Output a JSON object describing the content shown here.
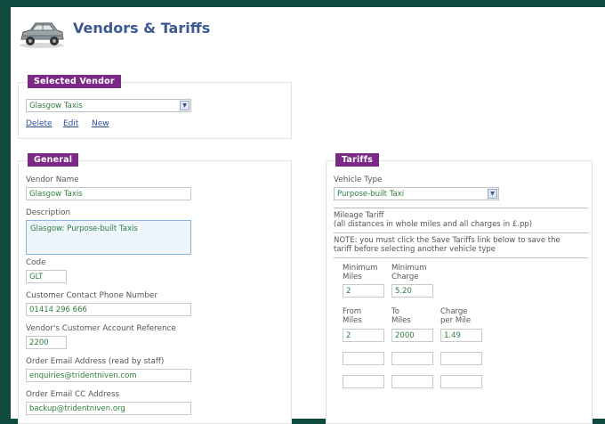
{
  "header": {
    "title": "Vendors & Tariffs",
    "icon": "car-icon"
  },
  "selected_vendor": {
    "tag": "Selected Vendor",
    "value": "Glasgow Taxis",
    "links": {
      "delete": "Delete",
      "edit": "Edit",
      "new": "New"
    }
  },
  "general": {
    "tag": "General",
    "vendor_name": {
      "label": "Vendor Name",
      "value": "Glasgow Taxis"
    },
    "description": {
      "label": "Description",
      "value": "Glasgow: Purpose-built Taxis"
    },
    "code": {
      "label": "Code",
      "value": "GLT"
    },
    "phone": {
      "label": "Customer Contact Phone Number",
      "value": "01414 296 666"
    },
    "account_ref": {
      "label": "Vendor's Customer Account Reference",
      "value": "2200"
    },
    "order_email": {
      "label": "Order Email Address (read by staff)",
      "value": "enquiries@tridentniven.com"
    },
    "cc_email": {
      "label": "Order Email CC Address",
      "value": "backup@tridentniven.org"
    }
  },
  "tariffs": {
    "tag": "Tariffs",
    "vehicle_type": {
      "label": "Vehicle Type",
      "value": "Purpose-built Taxi"
    },
    "mileage_title": "Mileage Tariff",
    "mileage_note": "(all distances in whole miles and all charges in £.pp)",
    "note_line1": "NOTE: you must click the Save Tariffs link below to save the",
    "note_line2": "tariff before selecting another vehicle type",
    "min_miles_label_1": "Minimum",
    "min_miles_label_2": "Miles",
    "min_charge_label_1": "Minimum",
    "min_charge_label_2": "Charge",
    "min_miles": "2",
    "min_charge": "5.20",
    "from_label_1": "From",
    "from_label_2": "Miles",
    "to_label_1": "To",
    "to_label_2": "Miles",
    "charge_label_1": "Charge",
    "charge_label_2": "per Mile",
    "rows": [
      {
        "from": "2",
        "to": "2000",
        "charge": "1.49"
      },
      {
        "from": "",
        "to": "",
        "charge": ""
      },
      {
        "from": "",
        "to": "",
        "charge": ""
      }
    ]
  },
  "colors": {
    "tag": "#7b2a86",
    "title": "#3d5a94",
    "value_text": "#2e7d3b",
    "link": "#2b4f9c"
  }
}
